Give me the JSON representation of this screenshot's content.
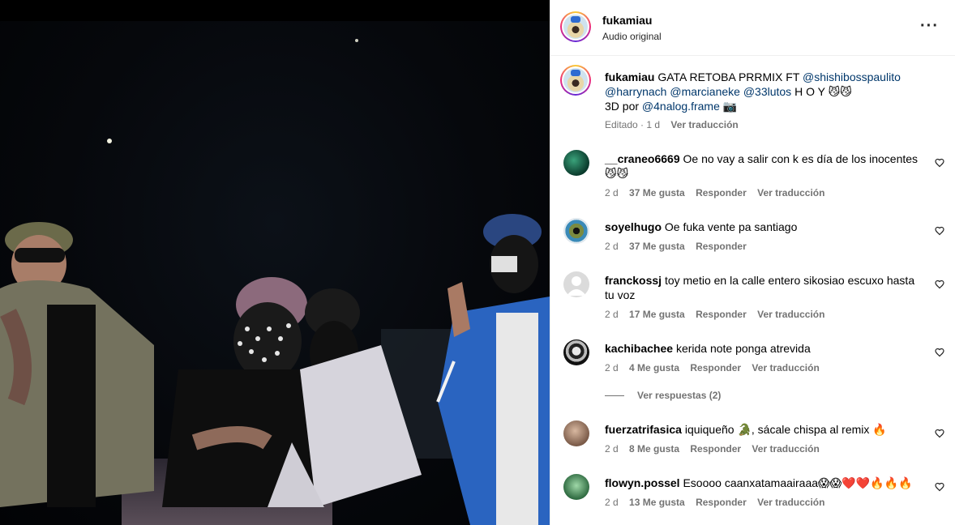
{
  "post": {
    "username": "fukamiau",
    "audio": "Audio original",
    "caption": {
      "username": "fukamiau",
      "text_before": "GATA RETOBA PRRMIX FT",
      "mention1": "@shishibosspaulito",
      "mention2": "@harrynach",
      "mention3": "@marcianeke",
      "mention4": "@33lutos",
      "text_after": "H O Y 😼😼",
      "credit_prefix": "3D por",
      "mention5": "@4nalog.frame",
      "credit_suffix": "📷",
      "edited": "Editado · 1 d",
      "translate": "Ver traducción"
    }
  },
  "comments": [
    {
      "user": "__craneo6669",
      "text": "Oe no vay a salir con k es día de los inocentes 😼😼",
      "age": "2 d",
      "likes": "37 Me gusta",
      "reply": "Responder",
      "translate": "Ver traducción"
    },
    {
      "user": "soyelhugo",
      "text": "Oe fuka vente pa santiago",
      "age": "2 d",
      "likes": "37 Me gusta",
      "reply": "Responder"
    },
    {
      "user": "franckossj",
      "text": "toy metio en la calle entero sikosiao escuxo hasta tu voz",
      "age": "2 d",
      "likes": "17 Me gusta",
      "reply": "Responder",
      "translate": "Ver traducción"
    },
    {
      "user": "kachibachee",
      "text": "kerida note ponga atrevida",
      "age": "2 d",
      "likes": "4 Me gusta",
      "reply": "Responder",
      "translate": "Ver traducción"
    },
    {
      "user": "fuerzatrifasica",
      "text": "iquiqueño 🐊, sácale chispa al remix 🔥",
      "age": "2 d",
      "likes": "8 Me gusta",
      "reply": "Responder",
      "translate": "Ver traducción"
    },
    {
      "user": "flowyn.possel",
      "text": "Esoooo caanxatamaairaaa😱😱❤️❤️🔥🔥🔥",
      "age": "2 d",
      "likes": "13 Me gusta",
      "reply": "Responder",
      "translate": "Ver traducción"
    }
  ],
  "view_replies": "Ver respuestas (2)",
  "colors": {
    "mention": "#00376b",
    "meta": "#737373",
    "divider": "#efefef"
  }
}
